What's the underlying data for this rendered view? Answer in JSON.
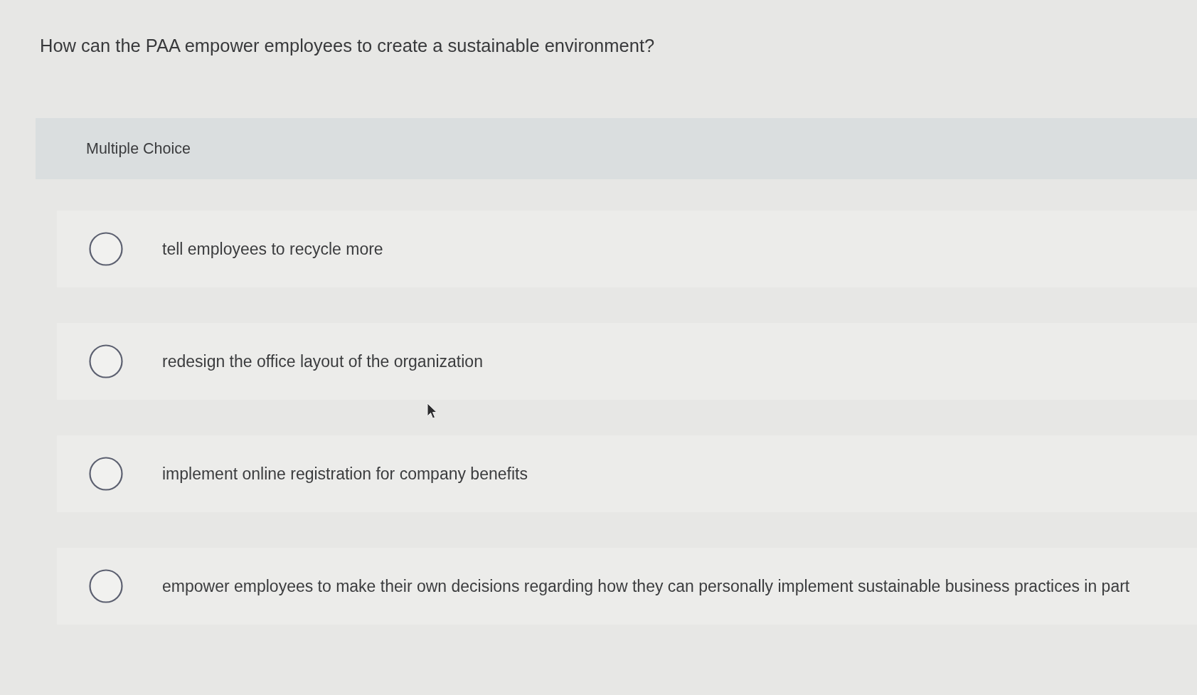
{
  "question": "How can the PAA empower employees to create a sustainable environment?",
  "section": {
    "title": "Multiple Choice"
  },
  "options": [
    {
      "label": "tell employees to recycle more",
      "selected": false
    },
    {
      "label": "redesign the office layout of the organization",
      "selected": false
    },
    {
      "label": "implement online registration for company benefits",
      "selected": false
    },
    {
      "label": "empower employees to make their own decisions regarding how they can personally implement sustainable business practices in part",
      "selected": false
    }
  ]
}
